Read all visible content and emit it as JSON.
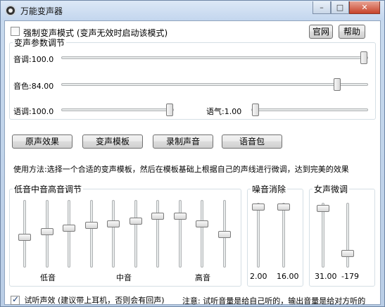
{
  "window": {
    "title": "万能变声器",
    "controls": {
      "minimize": "–",
      "maximize": "□",
      "close": "✕"
    }
  },
  "top": {
    "force_mode_label": "强制变声模式 (变声无效时启动该模式)",
    "force_mode_checked": false,
    "website_button": "官网",
    "help_button": "帮助"
  },
  "params": {
    "group_title": "变声参数调节",
    "pitch_label": "音调:100.0",
    "timbre_label": "音色:84.00",
    "speed_label": "语调:100.0",
    "breath_label": "语气:1.00",
    "pitch_level": 1.0,
    "timbre_level": 0.91,
    "speed_level": 1.0,
    "breath_level": 0.0
  },
  "buttons": {
    "original": "原声效果",
    "template": "变声模板",
    "record": "录制声音",
    "voice_pack": "语音包"
  },
  "usage_text": "使用方法:选择一个合适的变声模板，然后在模板基础上根据自己的声线进行微调，达到完美的效果",
  "eq": {
    "group_title": "低音中音高音调节",
    "low_label": "低音",
    "mid_label": "中音",
    "high_label": "高音",
    "levels": [
      0.45,
      0.55,
      0.6,
      0.65,
      0.67,
      0.72,
      0.8,
      0.8,
      0.67,
      0.5
    ]
  },
  "noise": {
    "group_title": "噪音消除",
    "values": [
      "2.00",
      "16.00"
    ],
    "levels": [
      1.0,
      1.0
    ]
  },
  "female": {
    "group_title": "女声微调",
    "values": [
      "31.00",
      "-179"
    ],
    "levels": [
      0.97,
      0.18
    ]
  },
  "bottom": {
    "listen_label": "试听声效 (建议带上耳机，否则会有回声)",
    "listen_checked": true,
    "note": "注意: 试听音量是给自己听的，输出音量是给对方听的"
  }
}
